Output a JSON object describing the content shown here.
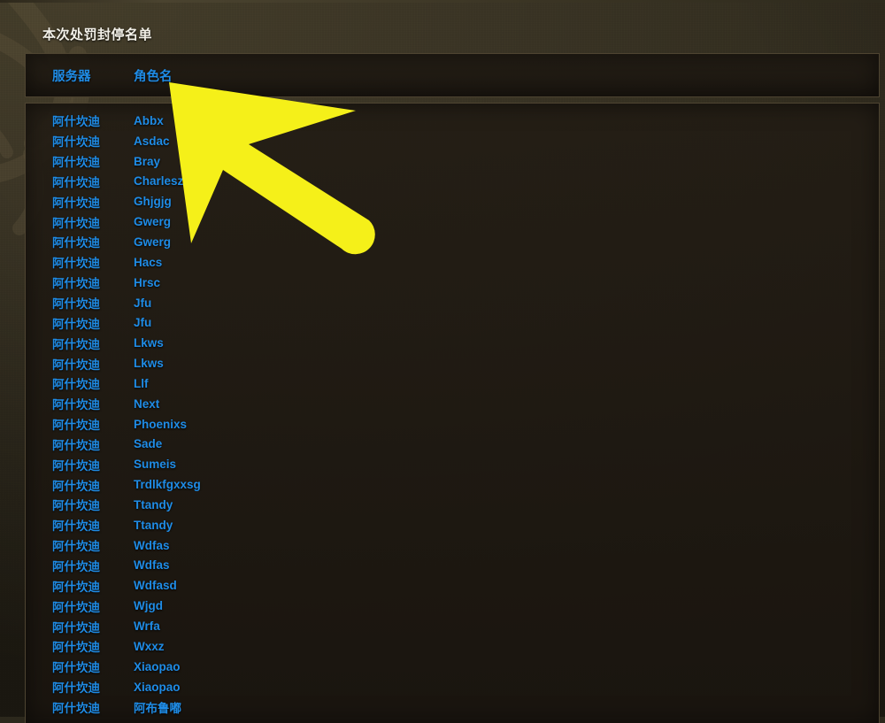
{
  "page": {
    "title": "本次处罚封停名单"
  },
  "table": {
    "columns": [
      {
        "key": "server",
        "label": "服务器"
      },
      {
        "key": "name",
        "label": "角色名"
      }
    ],
    "rows": [
      {
        "server": "阿什坎迪",
        "name": "Abbx"
      },
      {
        "server": "阿什坎迪",
        "name": "Asdac"
      },
      {
        "server": "阿什坎迪",
        "name": "Bray"
      },
      {
        "server": "阿什坎迪",
        "name": "Charleszs"
      },
      {
        "server": "阿什坎迪",
        "name": "Ghjgjg"
      },
      {
        "server": "阿什坎迪",
        "name": "Gwerg"
      },
      {
        "server": "阿什坎迪",
        "name": "Gwerg"
      },
      {
        "server": "阿什坎迪",
        "name": "Hacs"
      },
      {
        "server": "阿什坎迪",
        "name": "Hrsc"
      },
      {
        "server": "阿什坎迪",
        "name": "Jfu"
      },
      {
        "server": "阿什坎迪",
        "name": "Jfu"
      },
      {
        "server": "阿什坎迪",
        "name": "Lkws"
      },
      {
        "server": "阿什坎迪",
        "name": "Lkws"
      },
      {
        "server": "阿什坎迪",
        "name": "Llf"
      },
      {
        "server": "阿什坎迪",
        "name": "Next"
      },
      {
        "server": "阿什坎迪",
        "name": "Phoenixs"
      },
      {
        "server": "阿什坎迪",
        "name": "Sade"
      },
      {
        "server": "阿什坎迪",
        "name": "Sumeis"
      },
      {
        "server": "阿什坎迪",
        "name": "Trdlkfgxxsg"
      },
      {
        "server": "阿什坎迪",
        "name": "Ttandy"
      },
      {
        "server": "阿什坎迪",
        "name": "Ttandy"
      },
      {
        "server": "阿什坎迪",
        "name": "Wdfas"
      },
      {
        "server": "阿什坎迪",
        "name": "Wdfas"
      },
      {
        "server": "阿什坎迪",
        "name": "Wdfasd"
      },
      {
        "server": "阿什坎迪",
        "name": "Wjgd"
      },
      {
        "server": "阿什坎迪",
        "name": "Wrfa"
      },
      {
        "server": "阿什坎迪",
        "name": "Wxxz"
      },
      {
        "server": "阿什坎迪",
        "name": "Xiaopao"
      },
      {
        "server": "阿什坎迪",
        "name": "Xiaopao"
      },
      {
        "server": "阿什坎迪",
        "name": "阿布鲁嘟"
      }
    ]
  },
  "annotation": {
    "arrow": {
      "name": "yellow-pointer-arrow",
      "color": "#f5f019",
      "points_at": "角色名"
    }
  },
  "colors": {
    "link_blue": "#1f8ce6",
    "title_text": "#f2f0e8",
    "panel_border": "#4e4431",
    "background_dark": "#332e20",
    "arrow_yellow": "#f5f019"
  }
}
